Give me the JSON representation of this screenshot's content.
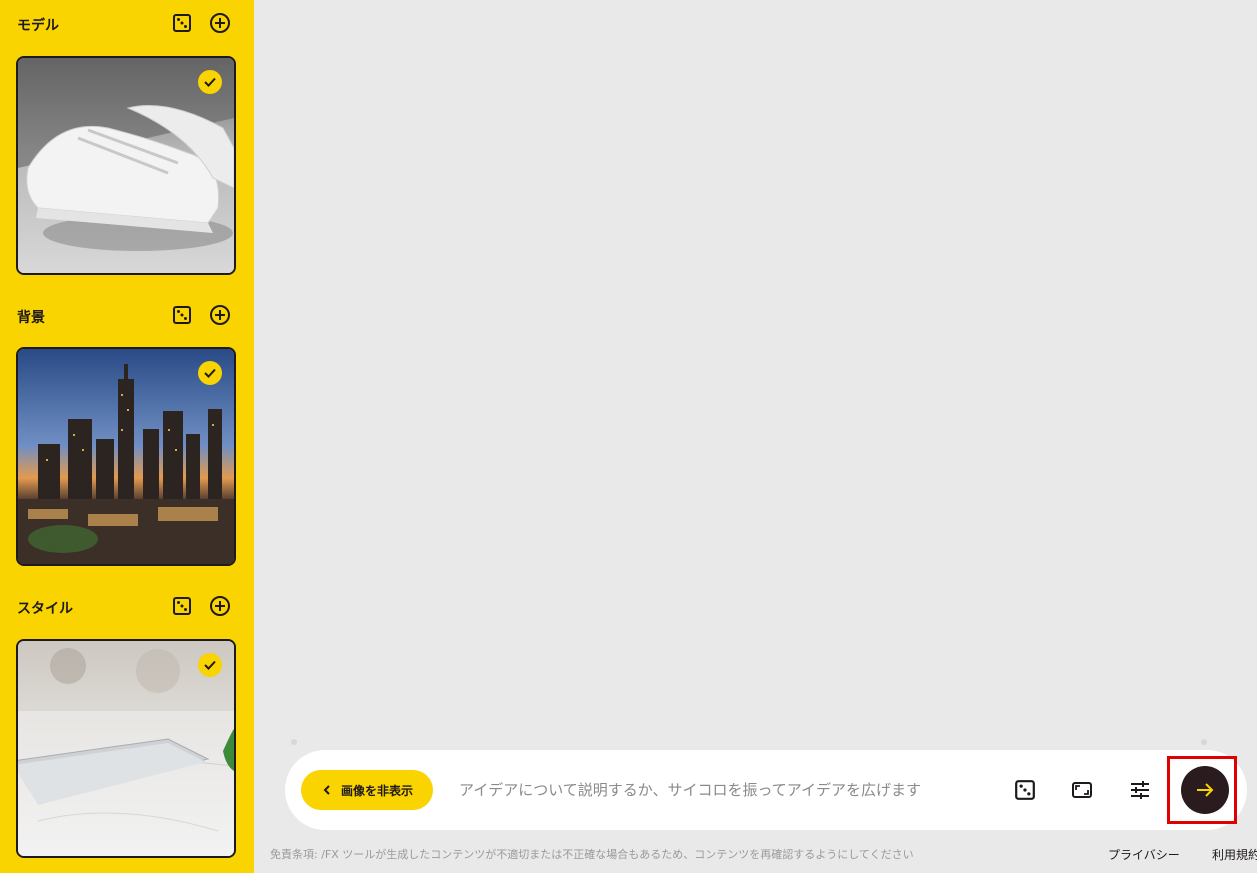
{
  "sidebar": {
    "sections": [
      {
        "title": "モデル",
        "dice_icon": "dice-icon",
        "add_icon": "add-circle-icon",
        "selected": true
      },
      {
        "title": "背景",
        "dice_icon": "dice-icon",
        "add_icon": "add-circle-icon",
        "selected": true
      },
      {
        "title": "スタイル",
        "dice_icon": "dice-icon",
        "add_icon": "add-circle-icon",
        "selected": true
      }
    ]
  },
  "composer": {
    "toggle_label": "画像を非表示",
    "prompt_placeholder": "アイデアについて説明するか、サイコロを振ってアイデアを広げます",
    "prompt_value": "",
    "tools": [
      "dice-icon",
      "aspect-ratio-icon",
      "sliders-icon"
    ],
    "send_icon": "arrow-right-icon"
  },
  "footer": {
    "disclaimer": "免責条項: /FX ツールが生成したコンテンツが不適切または不正確な場合もあるため、コンテンツを再確認するようにしてください",
    "privacy": "プライバシー",
    "terms": "利用規約"
  },
  "colors": {
    "sidebar_bg": "#f9d400",
    "canvas_bg": "#e9e9e9",
    "send_bg": "#2a1b1f",
    "send_arrow": "#f9d400",
    "highlight": "#e00000"
  }
}
